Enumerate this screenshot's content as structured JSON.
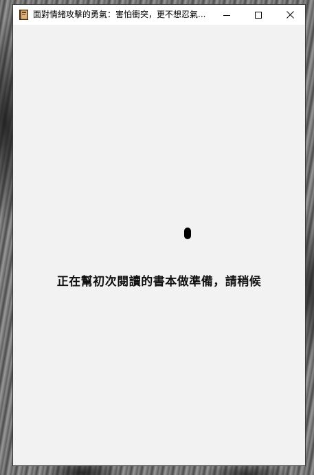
{
  "window": {
    "title": "面對情緒攻擊的勇氣：害怕衝突，更不想忍氣...",
    "icon": "book-icon",
    "controls": {
      "minimize": "minimize-icon",
      "maximize": "maximize-icon",
      "close": "close-icon"
    }
  },
  "content": {
    "spinner": "loading-spinner",
    "message": "正在幫初次閱讀的書本做準備，請稍候"
  },
  "colors": {
    "titlebar": "#ffffff",
    "content_bg": "#f2f2f2",
    "text": "#111111"
  }
}
